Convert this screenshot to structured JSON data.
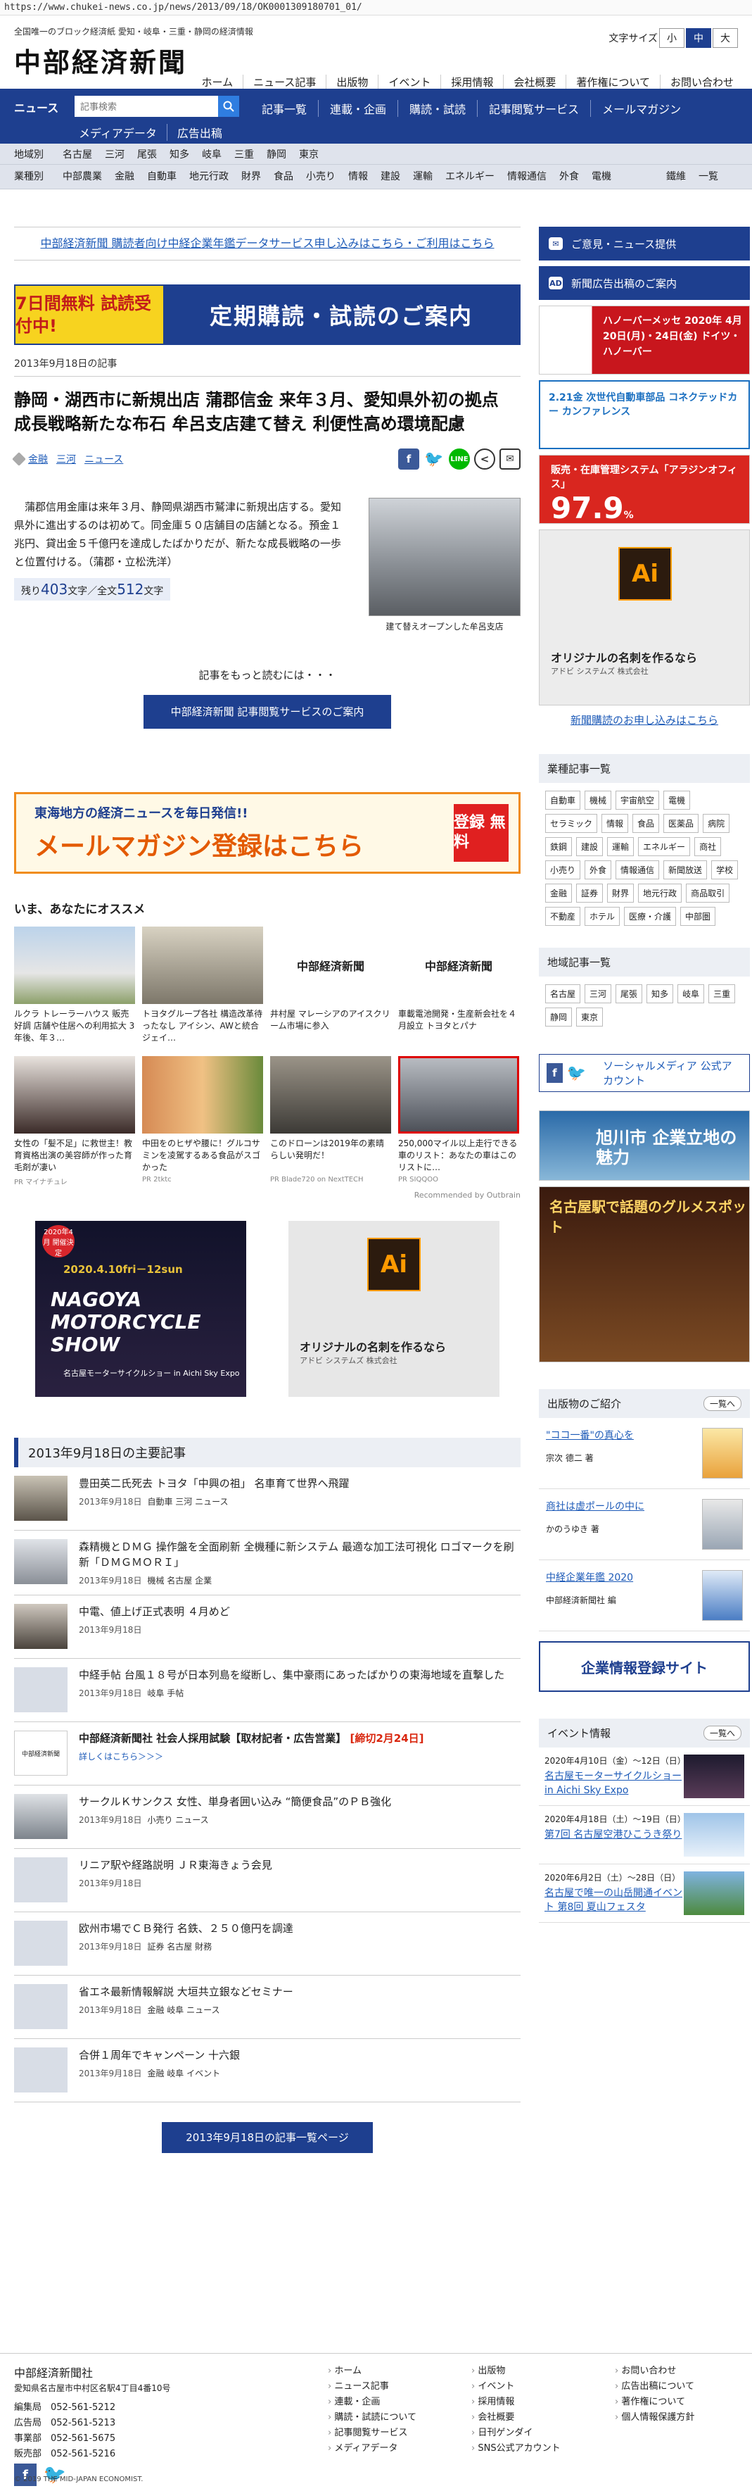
{
  "url": "https://www.chukei-news.co.jp/news/2013/09/18/OK0001309180701_01/",
  "header": {
    "tagline": "全国唯一のブロック経済紙 愛知・岐阜・三重・静岡の経済情報",
    "logo": "中部経済新聞",
    "font_size_label": "文字サイズ",
    "font_sizes": [
      "小",
      "中",
      "大"
    ],
    "topnav": [
      "ホーム",
      "ニュース記事",
      "出版物",
      "イベント",
      "採用情報",
      "会社概要",
      "著作権について",
      "お問い合わせ"
    ]
  },
  "mainnav": {
    "label": "ニュース",
    "search_placeholder": "記事検索",
    "row1": [
      "記事一覧",
      "連載・企画",
      "購読・試読",
      "記事閲覧サービス",
      "メールマガジン"
    ],
    "row2": [
      "メディアデータ",
      "広告出稿"
    ]
  },
  "subnav": {
    "region_label": "地域別",
    "regions": [
      "名古屋",
      "三河",
      "尾張",
      "知多",
      "岐阜",
      "三重",
      "静岡",
      "東京"
    ],
    "industry_label": "業種別",
    "industries": [
      "中部農業",
      "金融",
      "自動車",
      "地元行政",
      "財界",
      "食品",
      "小売り",
      "情報",
      "建設",
      "運輸",
      "エネルギー",
      "情報通信",
      "外食",
      "電機",
      "鐵維",
      "一覧"
    ]
  },
  "notice": "中部経済新聞 購読者向け中経企業年鑑データサービス申し込みはこちら・ご利用はこちら",
  "banner": {
    "left": "7日間無料 試読受付中!",
    "right": "定期購読・試読のご案内"
  },
  "article": {
    "date": "2013年9月18日の記事",
    "title": "静岡・湖西市に新規出店 蒲郡信金 来年３月、愛知県外初の拠点 成長戦略新たな布石 牟呂支店建て替え 利便性高め環境配慮",
    "tags": [
      "金融",
      "三河",
      "ニュース"
    ],
    "body": "蒲郡信用金庫は来年３月、静岡県湖西市鷲津に新規出店する。愛知県外に進出するのは初めて。同金庫５０店舗目の店舗となる。預金１兆円、貸出金５千億円を達成したばかりだが、新たな成長戦略の一歩と位置付ける。（蒲郡・立松洗洋）",
    "photo_caption": "建て替えオープンした牟呂支店",
    "remain_prefix": "残り",
    "remain_count": "403",
    "remain_mid": "文字／全文",
    "total_count": "512",
    "remain_suffix": "文字",
    "more_text": "記事をもっと読むには・・・",
    "service_btn": "中部経済新聞 記事閲覧サービスのご案内"
  },
  "mail_banner": {
    "line1": "東海地方の経済ニュースを毎日発信!!",
    "line2": "メールマガジン登録はこちら",
    "badge": "登録 無料"
  },
  "recommend": {
    "heading": "いま、あなたにオススメ",
    "items": [
      {
        "t": "ルクラ トレーラーハウス 販売好調 店舗や住居への利用拡大 3年後、年３…",
        "s": ""
      },
      {
        "t": "トヨタグループ各社 構造改革待ったなし アイシン、AWと統合 ジェイ…",
        "s": ""
      },
      {
        "t": "井村屋 マレーシアのアイスクリーム市場に参入",
        "s": ""
      },
      {
        "t": "車載電池開発・生産新会社を４月設立 トヨタとパナ",
        "s": ""
      },
      {
        "t": "女性の「髪不足」に救世主！教育資格出演の美容師が作った育毛剤が凄い",
        "s": "PR マイナチュレ"
      },
      {
        "t": "中田をのヒザや腰に！グルコサミンを凌駕するある食品がスゴかった",
        "s": "PR 2tktc"
      },
      {
        "t": "このドローンは2019年の素晴らしい発明だ！",
        "s": "PR Blade720 on NextTECH"
      },
      {
        "t": "250,000マイル以上走行できる車のリスト：あなたの車はこのリストに…",
        "s": "PR SIQQOO"
      }
    ],
    "credit": "Recommended by Outbrain"
  },
  "ad_show": {
    "badge": "2020年4月 開催決定",
    "dates": "2020.4.10fri－12sun",
    "name": "NAGOYA MOTORCYCLE SHOW",
    "venue": "名古屋モーターサイクルショー in Aichi Sky Expo"
  },
  "ad_card": {
    "glyph": "Ai",
    "title": "オリジナルの名刺を作るなら",
    "sub": "アドビ システムズ 株式会社"
  },
  "list": {
    "heading": "2013年9月18日の主要記事",
    "items": [
      {
        "t": "豊田英二氏死去 トヨタ「中興の祖」 名車育て世界へ飛躍",
        "d": "2013年9月18日",
        "c": "自動車 三河 ニュース"
      },
      {
        "t": "森精機とＤＭＧ 操作盤を全面刷新 全機種に新システム 最適な加工法可視化 ロゴマークを刷新「ＤＭＧＭＯＲＩ」",
        "d": "2013年9月18日",
        "c": "機械 名古屋 企業"
      },
      {
        "t": "中電、値上げ正式表明 ４月めど",
        "d": "2013年9月18日",
        "c": ""
      },
      {
        "t": "中経手帖 台風１８号が日本列島を縦断し、集中豪雨にあったばかりの東海地域を直撃した",
        "d": "2013年9月18日",
        "c": "岐阜 手帖"
      },
      {
        "t": "サークルＫサンクス 女性、単身者囲い込み “簡便食品”のＰＢ強化",
        "d": "2013年9月18日",
        "c": "小売り ニュース"
      },
      {
        "t": "リニア駅や経路説明 ＪＲ東海きょう会見",
        "d": "2013年9月18日",
        "c": ""
      },
      {
        "t": "欧州市場でＣＢ発行 名鉄、２５０億円を調達",
        "d": "2013年9月18日",
        "c": "証券 名古屋 財務"
      },
      {
        "t": "省エネ最新情報解説 大垣共立銀などセミナー",
        "d": "2013年9月18日",
        "c": "金融 岐阜 ニュース"
      },
      {
        "t": "合併１周年でキャンペーン 十六銀",
        "d": "2013年9月18日",
        "c": "金融 岐阜 イベント"
      }
    ],
    "recruit_title": "中部経済新聞社 社会人採用試験【取材記者・広告営業】",
    "recruit_deadline": "[締切2月24日]",
    "recruit_more": "詳しくはこちら＞＞＞",
    "button": "2013年9月18日の記事一覧ページ"
  },
  "side": {
    "btn1": "ご意見・ニュース提供",
    "btn2": "新聞広告出稿のご案内",
    "ad1": "ハノーバーメッセ 2020年 4月20日(月)・24日(金) ドイツ・ハノーバー",
    "ad2": "2.21金 次世代自動車部品 コネクテッドカー カンファレンス",
    "ad3a": "販売・在庫管理システム「アラジンオフィス」",
    "ad3b": "97.9",
    "ad3c": "%",
    "ad4": {
      "glyph": "Ai",
      "title": "オリジナルの名刺を作るなら",
      "sub": "アドビ システムズ 株式会社"
    },
    "sub_link": "新聞購読のお申し込みはこちら",
    "industry_head": "業種記事一覧",
    "industry_tags": [
      "自動車",
      "機械",
      "宇宙航空",
      "電機",
      "セラミック",
      "情報",
      "食品",
      "医薬品",
      "病院",
      "鉄鋼",
      "建設",
      "運輸",
      "エネルギー",
      "商社",
      "小売り",
      "外食",
      "情報通信",
      "新聞放送",
      "学校",
      "金融",
      "証券",
      "財界",
      "地元行政",
      "商品取引",
      "不動産",
      "ホテル",
      "医療・介護",
      "中部圏"
    ],
    "region_head": "地域記事一覧",
    "region_tags": [
      "名古屋",
      "三河",
      "尾張",
      "知多",
      "岐阜",
      "三重",
      "静岡",
      "東京"
    ],
    "social": "ソーシャルメディア 公式アカウント",
    "ad5": "旭川市 企業立地の魅力",
    "ad6": "名古屋駅で話題のグルメスポット",
    "pub_head": "出版物のご紹介",
    "pub_more": "一覧へ",
    "pubs": [
      {
        "t": "\"ココ一番\"の真心を",
        "a": "宗次 德二 著"
      },
      {
        "t": "商社は虚ポールの中に",
        "a": "かのうゆき 著"
      },
      {
        "t": "中経企業年鑑 2020",
        "a": "中部経済新聞社 編"
      }
    ],
    "ad7": "企業情報登録サイト",
    "ev_head": "イベント情報",
    "ev_more": "一覧へ",
    "events": [
      {
        "d": "2020年4月10日（金）～12日（日）",
        "n": "名古屋モーターサイクルショー in Aichi Sky Expo"
      },
      {
        "d": "2020年4月18日（土）～19日（日）",
        "n": "第7回 名古屋空港ひこうき祭り"
      },
      {
        "d": "2020年6月2日（土）～28日（日）",
        "n": "名古屋で唯一の山岳開通イベント 第8回 夏山フェスタ"
      }
    ]
  },
  "footer": {
    "company": "中部経済新聞社",
    "address": "愛知県名古屋市中村区名駅4丁目4番10号",
    "phones": [
      "編集局　052-561-5212",
      "広告局　052-561-5213",
      "事業部　052-561-5675",
      "販売部　052-561-5216"
    ],
    "col1": [
      "ホーム",
      "ニュース記事",
      "連載・企画",
      "購読・試読について",
      "記事閲覧サービス",
      "メディアデータ"
    ],
    "col2": [
      "出版物",
      "イベント",
      "採用情報",
      "会社概要",
      "日刊ゲンダイ",
      "SNS公式アカウント"
    ],
    "col3": [
      "お問い合わせ",
      "広告出稿について",
      "著作権について",
      "個人情報保護方針"
    ],
    "copyright": "© 2019 THE MID-JAPAN ECONOMIST."
  },
  "colors": {
    "brand": "#1e3f8f",
    "accent": "#d9260e"
  }
}
